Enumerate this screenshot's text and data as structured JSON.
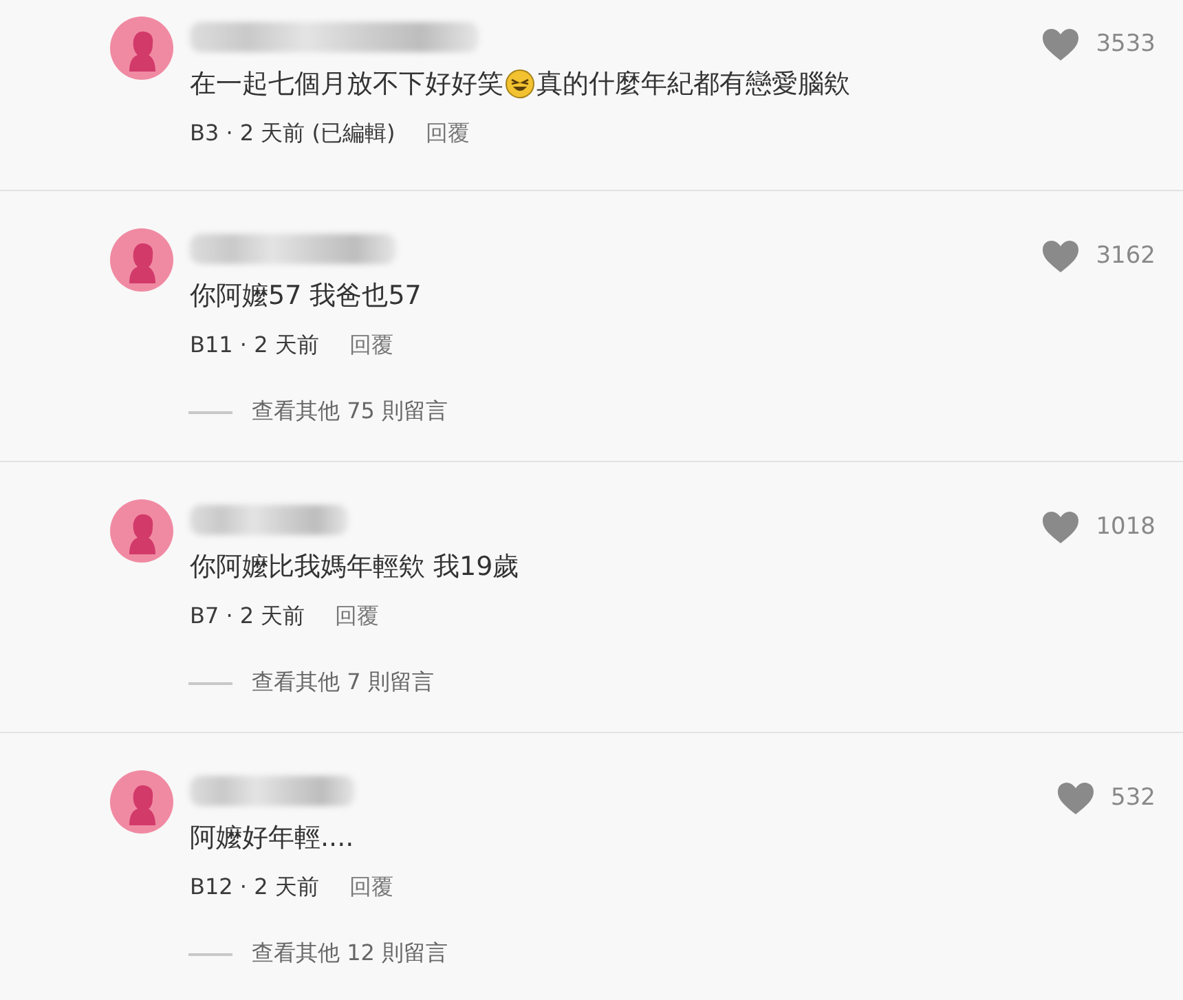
{
  "comments": [
    {
      "segments": [
        {
          "kind": "text",
          "text": "在一起七個月放不下好好笑"
        },
        {
          "kind": "emoji"
        },
        {
          "kind": "text",
          "text": "真的什麼年紀都有戀愛腦欸"
        }
      ],
      "meta": "B3 · 2 天前 (已編輯)",
      "reply": "回覆",
      "likes": "3533"
    },
    {
      "segments": [
        {
          "kind": "text",
          "text": "你阿嬤57 我爸也57"
        }
      ],
      "meta": "B11 · 2 天前",
      "reply": "回覆",
      "likes": "3162",
      "more_replies": "查看其他 75 則留言"
    },
    {
      "segments": [
        {
          "kind": "text",
          "text": "你阿嬤比我媽年輕欸 我19歲"
        }
      ],
      "meta": "B7 · 2 天前",
      "reply": "回覆",
      "likes": "1018",
      "more_replies": "查看其他 7 則留言"
    },
    {
      "segments": [
        {
          "kind": "text",
          "text": "阿嬤好年輕...."
        }
      ],
      "meta": "B12 · 2 天前",
      "reply": "回覆",
      "likes": "532",
      "more_replies": "查看其他 12 則留言"
    }
  ]
}
